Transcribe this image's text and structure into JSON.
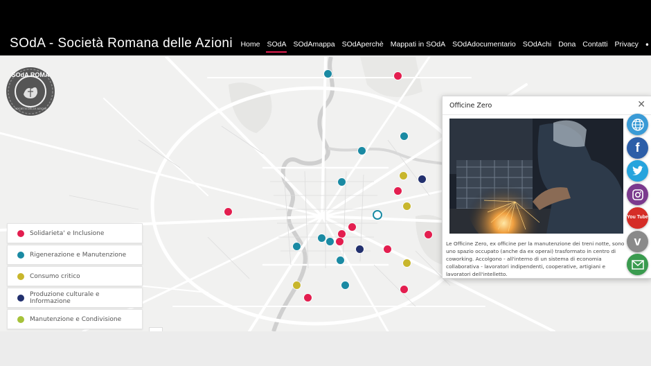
{
  "header": {
    "site_title": "SOdA - Società Romana delle Azioni",
    "nav": [
      "Home",
      "SOdA",
      "SOdAmappa",
      "SOdAperchè",
      "Mappati in SOdA",
      "SOdAdocumentario",
      "SOdAchi",
      "Dona",
      "Contatti",
      "Privacy"
    ],
    "active_nav": "SOdA"
  },
  "logo": {
    "top_text": "SOdA ROMA",
    "bottom_text": "SOCIETÀ DELLE AZIONI"
  },
  "colors": {
    "solidarieta": "#e31e4f",
    "rigenerazione": "#1a8aa3",
    "consumo": "#c8b62c",
    "produzione": "#22306e",
    "manutenzione": "#a6c23a",
    "accent": "#e31e4f"
  },
  "legend": [
    {
      "label": "Solidarieta' e Inclusione",
      "color": "#e31e4f"
    },
    {
      "label": "Rigenerazione e Manutenzione",
      "color": "#1a8aa3"
    },
    {
      "label": "Consumo critico",
      "color": "#c8b62c"
    },
    {
      "label": "Produzione culturale e Informazione",
      "color": "#22306e"
    },
    {
      "label": "Manutenzione e Condivisione",
      "color": "#a6c23a"
    }
  ],
  "popup": {
    "title": "Officine Zero",
    "description": "Le Officine Zero, ex officine per la manutenzione dei treni notte, sono uno spazio occupato (anche da ex operai) trasformato in centro di coworking. Accolgono - all'interno di un sistema di economia collaborativa - lavoratori indipendenti, cooperative, artigiani e lavoratori dell'intelletto."
  },
  "social_icons": [
    {
      "name": "website-icon",
      "color": "#3a9bd6"
    },
    {
      "name": "facebook-icon",
      "color": "#2c5ea8"
    },
    {
      "name": "twitter-icon",
      "color": "#27a4dd"
    },
    {
      "name": "instagram-icon",
      "color": "#7b3a8e"
    },
    {
      "name": "youtube-icon",
      "color": "#d52d27"
    },
    {
      "name": "vimeo-icon",
      "color": "#8a8a8a"
    },
    {
      "name": "email-icon",
      "color": "#3a9b4f"
    }
  ],
  "social_glyphs": {
    "facebook": "f",
    "youtube": "You Tube",
    "vimeo": "v"
  }
}
